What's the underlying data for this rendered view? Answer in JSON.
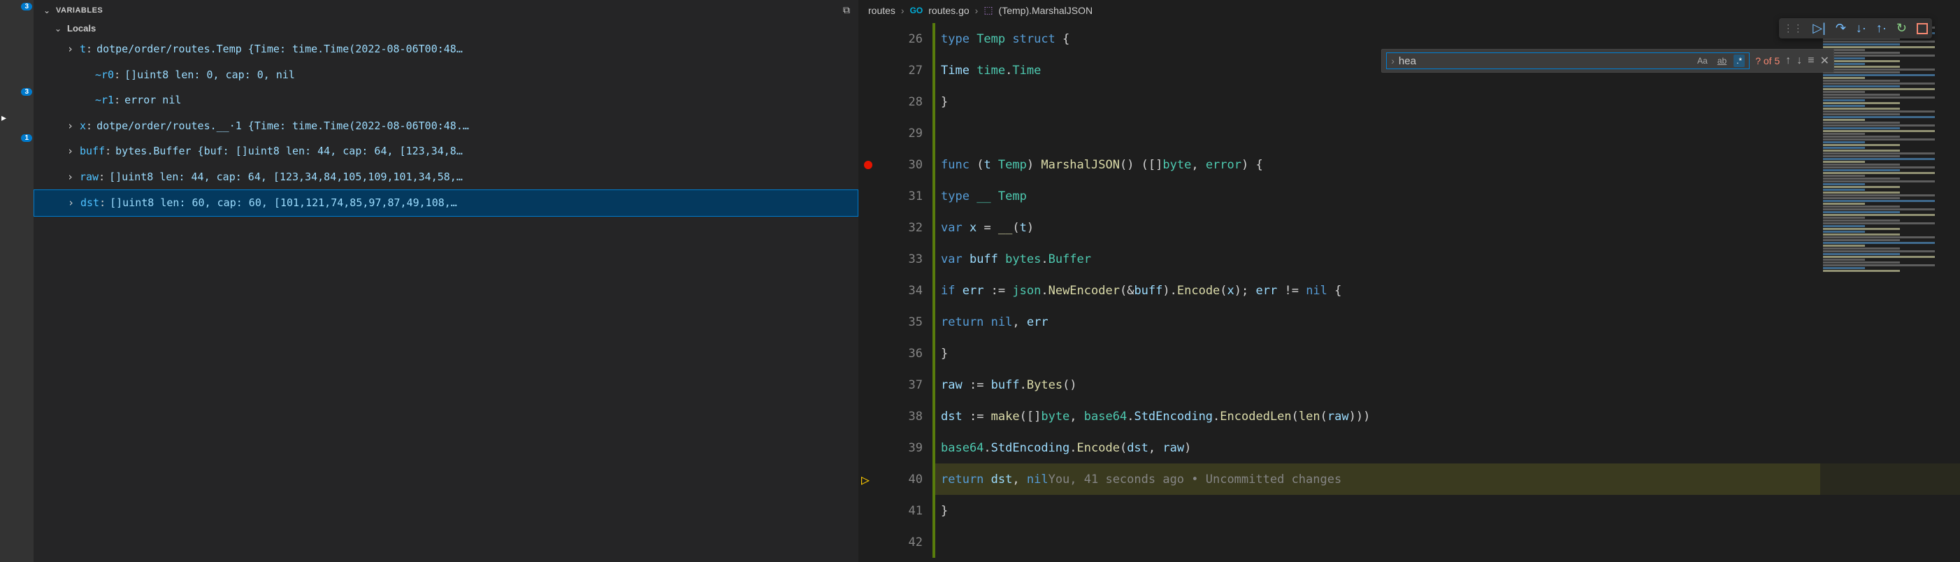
{
  "activity": {
    "badge1": "3",
    "badge2": "3",
    "badge3": "1"
  },
  "variables": {
    "section_title": "Variables",
    "locals_title": "Locals",
    "items": [
      {
        "expandable": true,
        "name": "t",
        "value": "dotpe/order/routes.Temp {Time: time.Time(2022-08-06T00:48…"
      },
      {
        "expandable": false,
        "name": "~r0",
        "value": "[]uint8 len: 0, cap: 0, nil",
        "indent": true
      },
      {
        "expandable": false,
        "name": "~r1",
        "value": "error nil",
        "indent": true
      },
      {
        "expandable": true,
        "name": "x",
        "value": "dotpe/order/routes.__·1 {Time: time.Time(2022-08-06T00:48.…"
      },
      {
        "expandable": true,
        "name": "buff",
        "value": "bytes.Buffer {buf: []uint8 len: 44, cap: 64, [123,34,8…"
      },
      {
        "expandable": true,
        "name": "raw",
        "value": "[]uint8 len: 44, cap: 64, [123,34,84,105,109,101,34,58,…"
      },
      {
        "expandable": true,
        "name": "dst",
        "value": "[]uint8 len: 60, cap: 60, [101,121,74,85,97,87,49,108,…",
        "selected": true
      }
    ]
  },
  "breadcrumb": {
    "folder": "routes",
    "file": "routes.go",
    "symbol": "(Temp).MarshalJSON"
  },
  "find": {
    "value": "hea",
    "count": "? of 5"
  },
  "code": {
    "lines": [
      {
        "n": 26,
        "mod": true,
        "tokens": [
          [
            "keyword",
            "type "
          ],
          [
            "type",
            "Temp "
          ],
          [
            "keyword",
            "struct "
          ],
          [
            "punct",
            "{"
          ]
        ]
      },
      {
        "n": 27,
        "mod": true,
        "indent": 1,
        "tokens": [
          [
            "var",
            "Time "
          ],
          [
            "type",
            "time"
          ],
          [
            "punct",
            "."
          ],
          [
            "type",
            "Time"
          ]
        ]
      },
      {
        "n": 28,
        "mod": true,
        "tokens": [
          [
            "punct",
            "}"
          ]
        ]
      },
      {
        "n": 29,
        "mod": true,
        "tokens": []
      },
      {
        "n": 30,
        "mod": true,
        "bp": true,
        "tokens": [
          [
            "keyword",
            "func "
          ],
          [
            "punct",
            "("
          ],
          [
            "var",
            "t "
          ],
          [
            "type",
            "Temp"
          ],
          [
            "punct",
            ") "
          ],
          [
            "func",
            "MarshalJSON"
          ],
          [
            "punct",
            "() ([]"
          ],
          [
            "type",
            "byte"
          ],
          [
            "punct",
            ", "
          ],
          [
            "type",
            "error"
          ],
          [
            "punct",
            ") {"
          ]
        ]
      },
      {
        "n": 31,
        "mod": true,
        "indent": 1,
        "tokens": [
          [
            "keyword",
            "type "
          ],
          [
            "type",
            "__ "
          ],
          [
            "type",
            "Temp"
          ]
        ]
      },
      {
        "n": 32,
        "mod": true,
        "indent": 1,
        "tokens": [
          [
            "keyword",
            "var "
          ],
          [
            "var",
            "x "
          ],
          [
            "punct",
            "= "
          ],
          [
            "func",
            "__"
          ],
          [
            "punct",
            "("
          ],
          [
            "var",
            "t"
          ],
          [
            "punct",
            ")"
          ]
        ]
      },
      {
        "n": 33,
        "mod": true,
        "indent": 1,
        "tokens": [
          [
            "keyword",
            "var "
          ],
          [
            "var",
            "buff "
          ],
          [
            "type",
            "bytes"
          ],
          [
            "punct",
            "."
          ],
          [
            "type",
            "Buffer"
          ]
        ]
      },
      {
        "n": 34,
        "mod": true,
        "indent": 1,
        "tokens": [
          [
            "keyword",
            "if "
          ],
          [
            "var",
            "err "
          ],
          [
            "punct",
            ":= "
          ],
          [
            "type",
            "json"
          ],
          [
            "punct",
            "."
          ],
          [
            "func",
            "NewEncoder"
          ],
          [
            "punct",
            "(&"
          ],
          [
            "var",
            "buff"
          ],
          [
            "punct",
            ")."
          ],
          [
            "func",
            "Encode"
          ],
          [
            "punct",
            "("
          ],
          [
            "var",
            "x"
          ],
          [
            "punct",
            "); "
          ],
          [
            "var",
            "err "
          ],
          [
            "punct",
            "!= "
          ],
          [
            "keyword",
            "nil "
          ],
          [
            "punct",
            "{"
          ]
        ]
      },
      {
        "n": 35,
        "mod": true,
        "indent": 2,
        "tokens": [
          [
            "keyword",
            "return "
          ],
          [
            "keyword",
            "nil"
          ],
          [
            "punct",
            ", "
          ],
          [
            "var",
            "err"
          ]
        ]
      },
      {
        "n": 36,
        "mod": true,
        "indent": 1,
        "tokens": [
          [
            "punct",
            "}"
          ]
        ]
      },
      {
        "n": 37,
        "mod": true,
        "indent": 1,
        "tokens": [
          [
            "var",
            "raw "
          ],
          [
            "punct",
            ":= "
          ],
          [
            "var",
            "buff"
          ],
          [
            "punct",
            "."
          ],
          [
            "func",
            "Bytes"
          ],
          [
            "punct",
            "()"
          ]
        ]
      },
      {
        "n": 38,
        "mod": true,
        "indent": 1,
        "tokens": [
          [
            "var",
            "dst "
          ],
          [
            "punct",
            ":= "
          ],
          [
            "func",
            "make"
          ],
          [
            "punct",
            "([]"
          ],
          [
            "type",
            "byte"
          ],
          [
            "punct",
            ", "
          ],
          [
            "type",
            "base64"
          ],
          [
            "punct",
            "."
          ],
          [
            "var",
            "StdEncoding"
          ],
          [
            "punct",
            "."
          ],
          [
            "func",
            "EncodedLen"
          ],
          [
            "punct",
            "("
          ],
          [
            "func",
            "len"
          ],
          [
            "punct",
            "("
          ],
          [
            "var",
            "raw"
          ],
          [
            "punct",
            ")))"
          ]
        ]
      },
      {
        "n": 39,
        "mod": true,
        "indent": 1,
        "tokens": [
          [
            "type",
            "base64"
          ],
          [
            "punct",
            "."
          ],
          [
            "var",
            "StdEncoding"
          ],
          [
            "punct",
            "."
          ],
          [
            "func",
            "Encode"
          ],
          [
            "punct",
            "("
          ],
          [
            "var",
            "dst"
          ],
          [
            "punct",
            ", "
          ],
          [
            "var",
            "raw"
          ],
          [
            "punct",
            ")"
          ]
        ]
      },
      {
        "n": 40,
        "mod": true,
        "indent": 1,
        "current": true,
        "cursor": true,
        "tokens": [
          [
            "keyword",
            "return "
          ],
          [
            "var",
            "dst"
          ],
          [
            "punct",
            ", "
          ],
          [
            "keyword",
            "nil"
          ]
        ],
        "lens": "You, 41 seconds ago • Uncommitted changes"
      },
      {
        "n": 41,
        "mod": true,
        "tokens": [
          [
            "punct",
            "}"
          ]
        ]
      },
      {
        "n": 42,
        "mod": true,
        "tokens": []
      }
    ]
  }
}
